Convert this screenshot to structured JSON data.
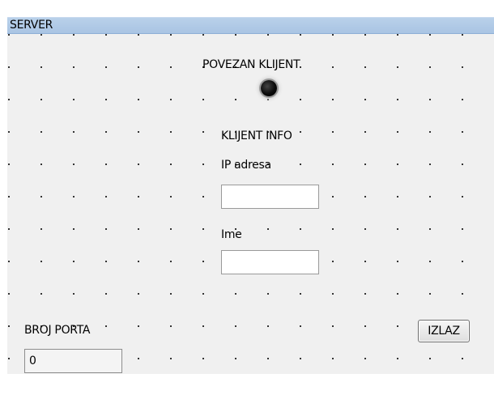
{
  "window": {
    "title": "SERVER"
  },
  "status": {
    "connected_label": "POVEZAN KLIJENT"
  },
  "client_info": {
    "heading": "KLIJENT INFO",
    "ip_label": "IP adresa",
    "ip_value": "",
    "name_label": "Ime",
    "name_value": ""
  },
  "port": {
    "label": "BROJ PORTA",
    "value": "0"
  },
  "actions": {
    "exit_label": "IZLAZ"
  },
  "colors": {
    "title_bar": "#b9d1ea",
    "form_background": "#f0f0f0",
    "indicator": "#000000"
  },
  "icons": {
    "status_indicator": "led-indicator-icon"
  }
}
